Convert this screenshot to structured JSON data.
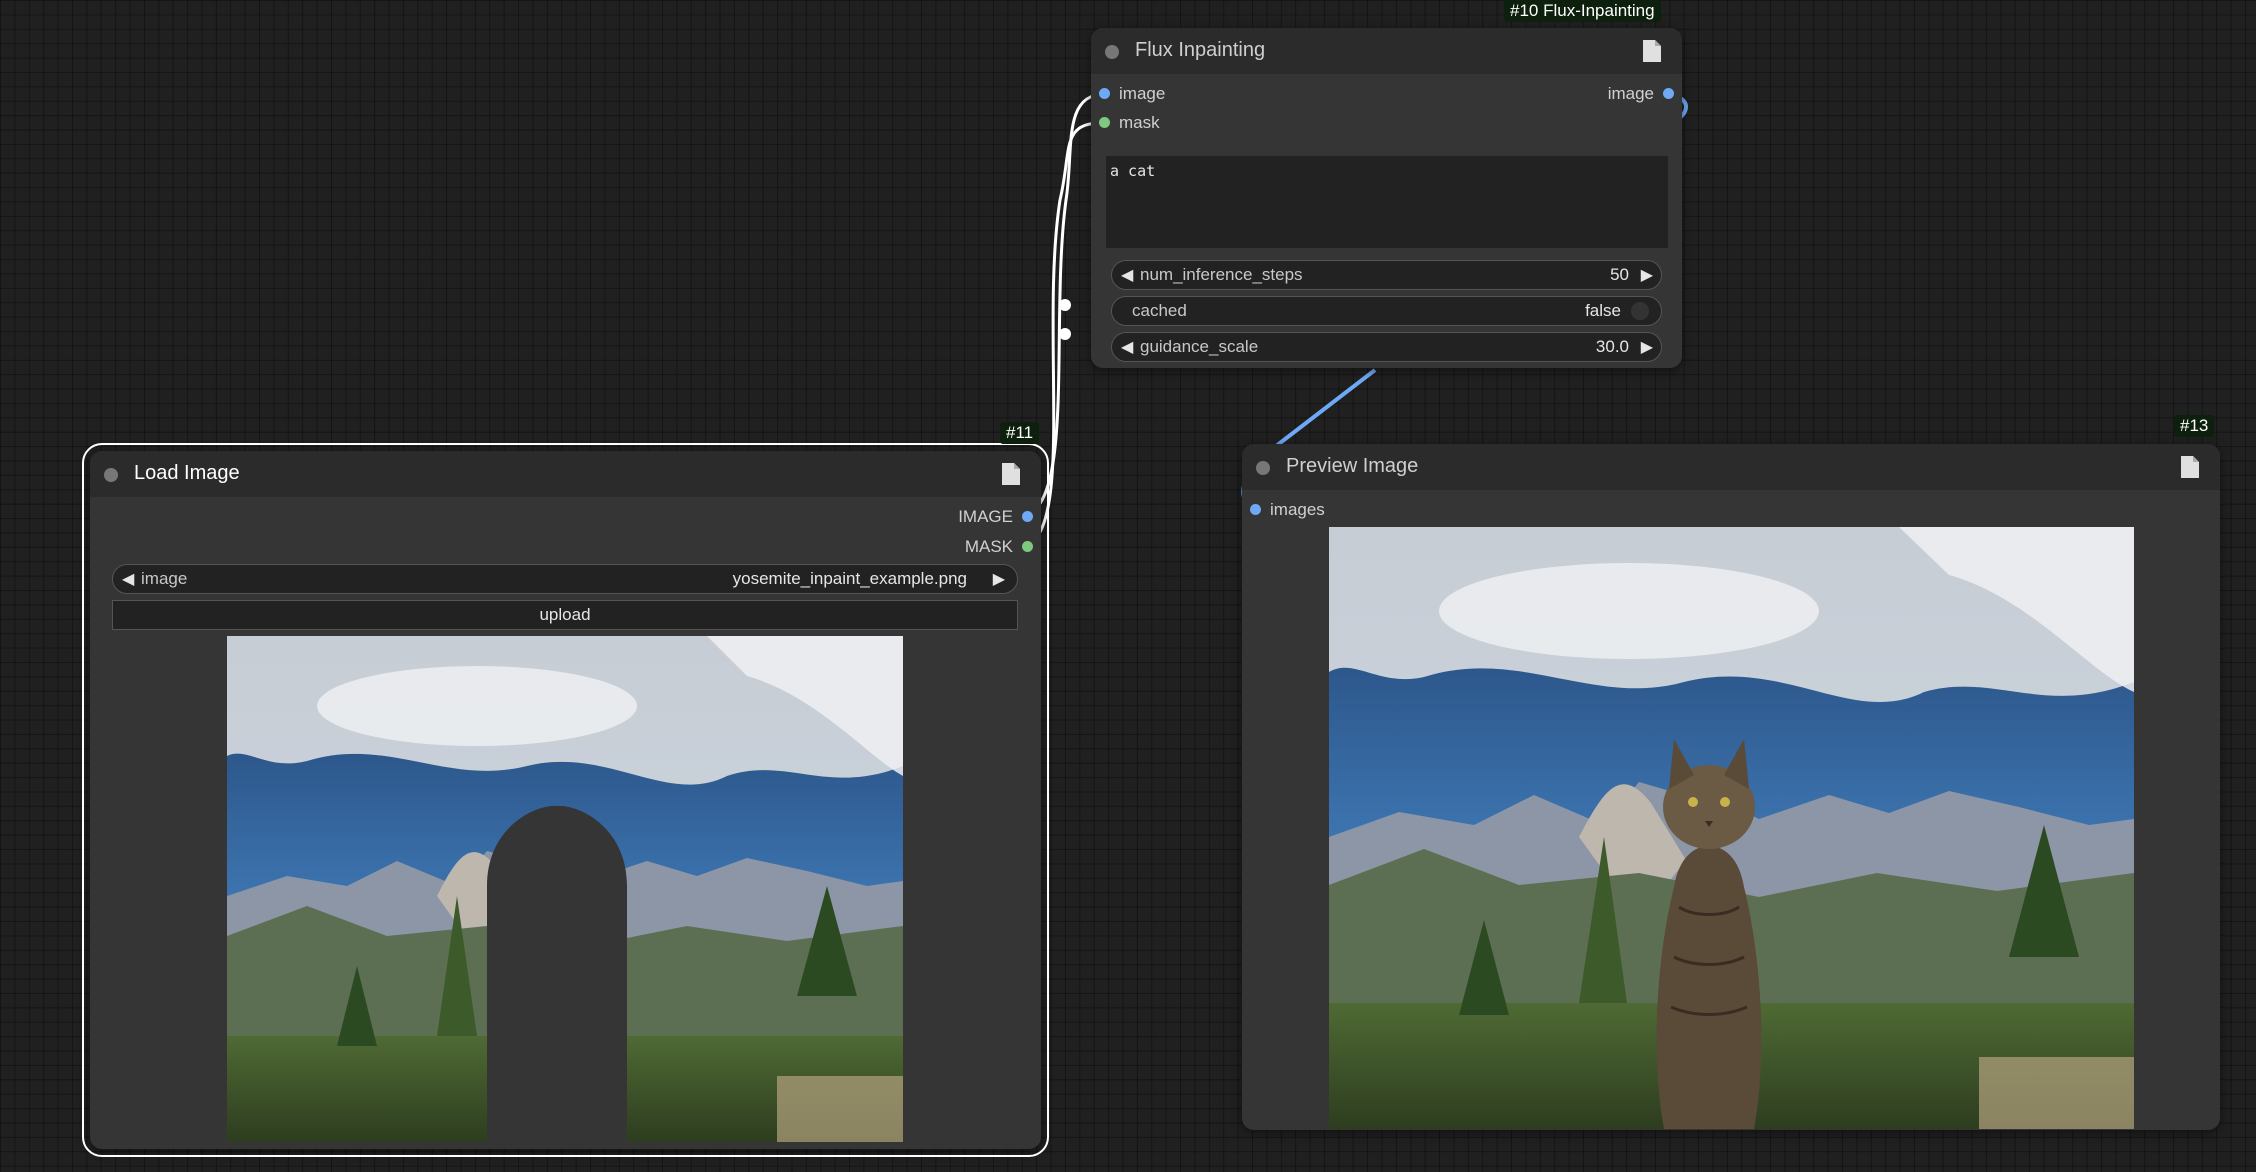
{
  "flux_node": {
    "badge": "#10 Flux-Inpainting",
    "title": "Flux Inpainting",
    "input_image_label": "image",
    "input_mask_label": "mask",
    "output_image_label": "image",
    "prompt_text": "a cat",
    "steps": {
      "label": "num_inference_steps",
      "value": "50"
    },
    "cached": {
      "label": "cached",
      "value": "false"
    },
    "guidance": {
      "label": "guidance_scale",
      "value": "30.0"
    }
  },
  "load_node": {
    "badge": "#11",
    "title": "Load Image",
    "output_image_label": "IMAGE",
    "output_mask_label": "MASK",
    "image_widget": {
      "label": "image",
      "value": "yosemite_inpaint_example.png"
    },
    "upload_label": "upload"
  },
  "preview_node": {
    "badge": "#13",
    "title": "Preview Image",
    "input_images_label": "images"
  },
  "colors": {
    "image_link": "#6fa8f5",
    "mask_link": "#7ec97e",
    "selected_link": "#ffffff",
    "canvas": "#202020",
    "node_body": "#353535"
  },
  "icons": {
    "node_menu": "document-icon",
    "left_arrow": "◀",
    "right_arrow": "▶"
  }
}
